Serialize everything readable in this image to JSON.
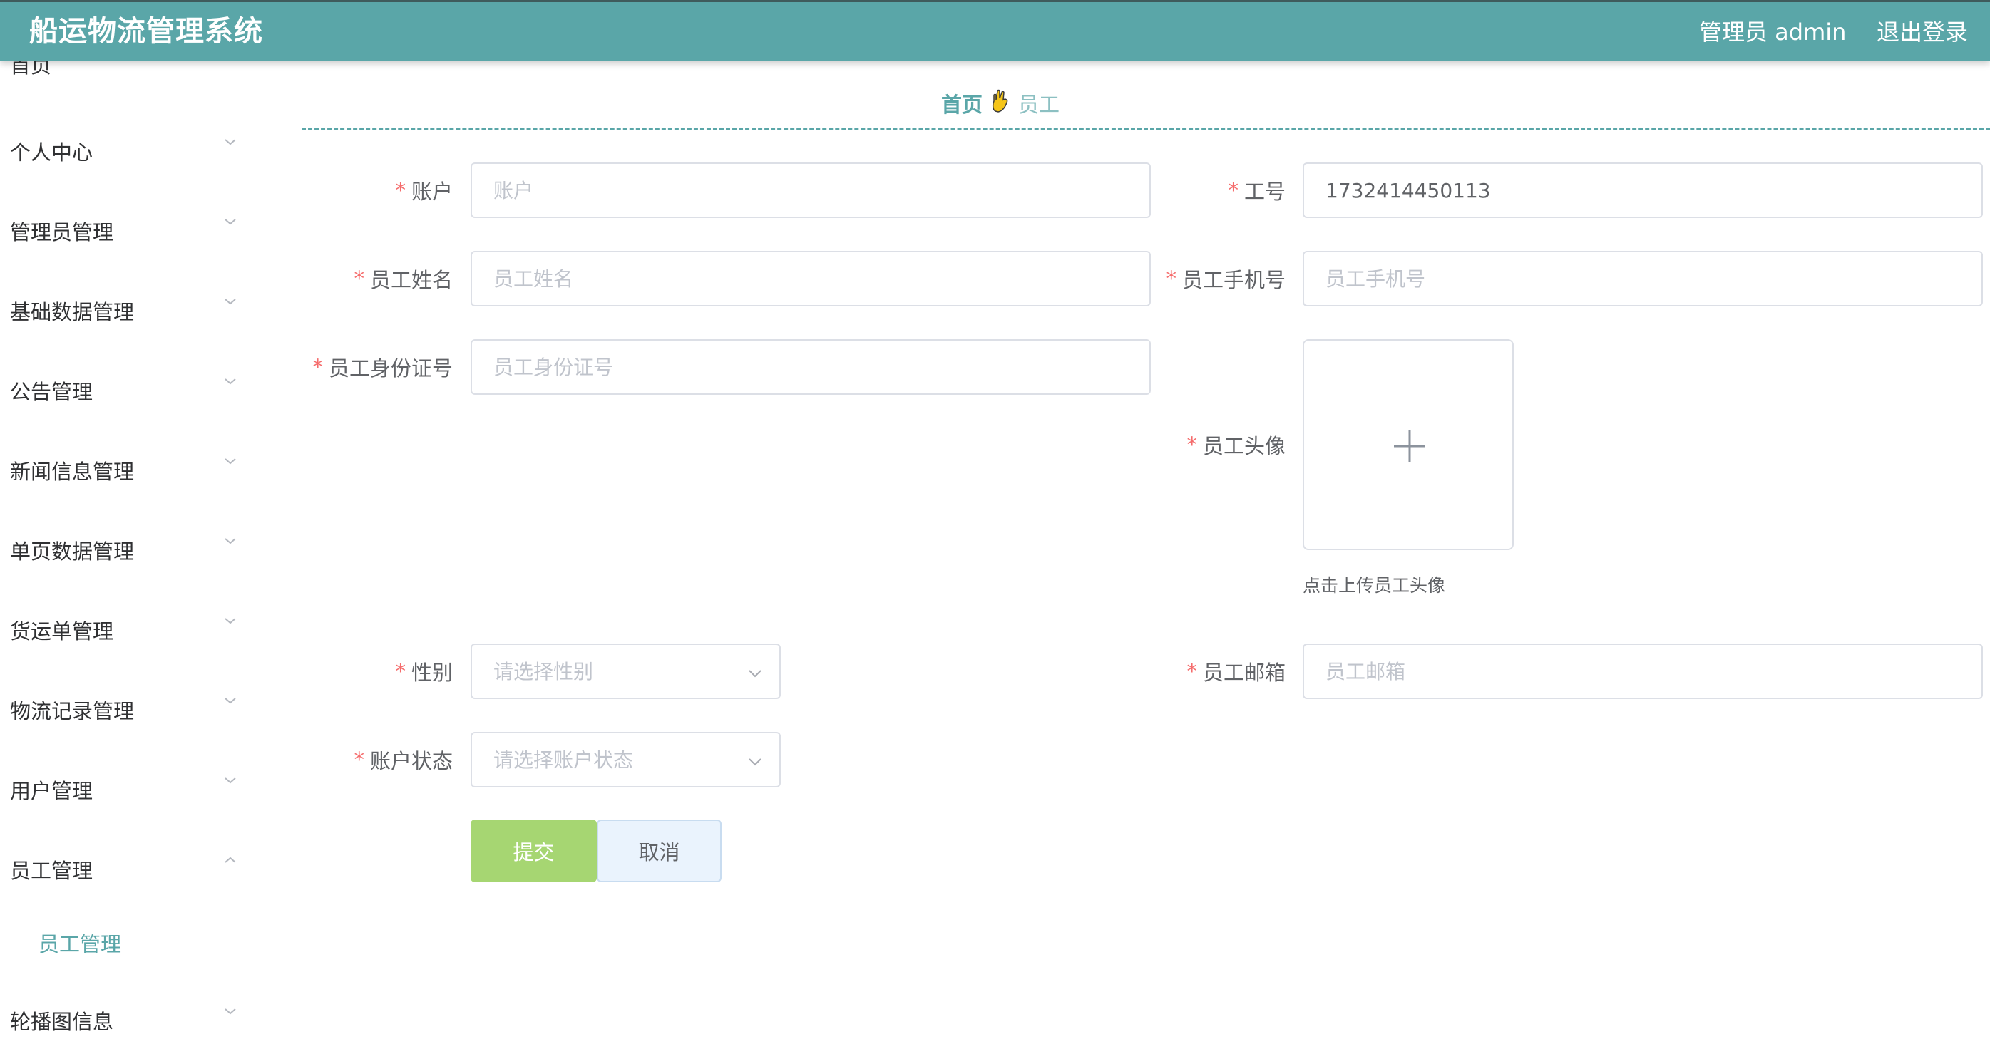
{
  "header": {
    "app_title": "船运物流管理系统",
    "user_label": "管理员 admin",
    "logout_label": "退出登录",
    "color": "#5aa6a8"
  },
  "sidebar": {
    "items": [
      {
        "label": "首页"
      },
      {
        "label": "个人中心"
      },
      {
        "label": "管理员管理"
      },
      {
        "label": "基础数据管理"
      },
      {
        "label": "公告管理"
      },
      {
        "label": "新闻信息管理"
      },
      {
        "label": "单页数据管理"
      },
      {
        "label": "货运单管理"
      },
      {
        "label": "物流记录管理"
      },
      {
        "label": "用户管理"
      },
      {
        "label": "员工管理",
        "expanded": true,
        "children": [
          {
            "label": "员工管理",
            "active": true
          }
        ]
      },
      {
        "label": "轮播图信息"
      }
    ]
  },
  "breadcrumb": {
    "home": "首页",
    "separator_icon": "ok-hand-icon",
    "current": "员工"
  },
  "form": {
    "account": {
      "label": "账户",
      "placeholder": "账户",
      "value": ""
    },
    "job_number": {
      "label": "工号",
      "value": "1732414450113"
    },
    "name": {
      "label": "员工姓名",
      "placeholder": "员工姓名",
      "value": ""
    },
    "phone": {
      "label": "员工手机号",
      "placeholder": "员工手机号",
      "value": ""
    },
    "id_card": {
      "label": "员工身份证号",
      "placeholder": "员工身份证号",
      "value": ""
    },
    "avatar": {
      "label": "员工头像",
      "tip": "点击上传员工头像"
    },
    "gender": {
      "label": "性别",
      "placeholder": "请选择性别"
    },
    "email": {
      "label": "员工邮箱",
      "placeholder": "员工邮箱",
      "value": ""
    },
    "status": {
      "label": "账户状态",
      "placeholder": "请选择账户状态"
    },
    "submit_label": "提交",
    "cancel_label": "取消"
  }
}
